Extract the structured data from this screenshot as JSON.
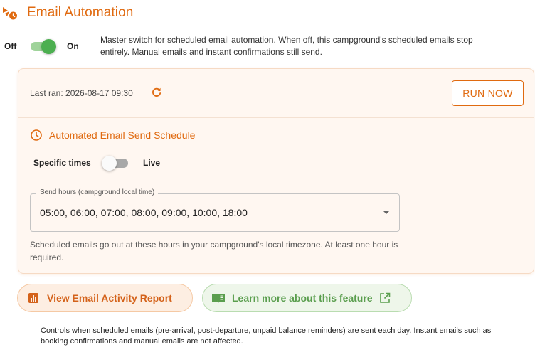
{
  "header": {
    "title": "Email Automation",
    "icon": "campground-automation-icon"
  },
  "master_switch": {
    "off_label": "Off",
    "on_label": "On",
    "state": "on",
    "description": "Master switch for scheduled email automation. When off, this campground's scheduled emails stop entirely. Manual emails and instant confirmations still send."
  },
  "status": {
    "last_ran": "Last ran: 2026-08-17 09:30",
    "refresh_icon": "refresh-icon",
    "run_now_label": "RUN NOW"
  },
  "schedule": {
    "title": "Automated Email Send Schedule",
    "icon": "clock-icon",
    "mode_left_label": "Specific times",
    "mode_right_label": "Live",
    "mode_state": "specific-times",
    "send_hours_label": "Send hours (campground local time)",
    "send_hours_value": "05:00, 06:00, 07:00, 08:00, 09:00, 10:00, 18:00",
    "helper_text": "Scheduled emails go out at these hours in your campground's local timezone. At least one hour is required."
  },
  "actions": {
    "report_label": "View Email Activity Report",
    "report_icon": "bar-chart-icon",
    "learn_label": "Learn more about this feature",
    "learn_icon": "book-icon",
    "external_icon": "external-link-icon"
  },
  "footer": {
    "note": "Controls when scheduled emails (pre-arrival, post-departure, unpaid balance reminders) are sent each day. Instant emails such as booking confirmations and manual emails are not affected."
  },
  "colors": {
    "accent": "#e06a10",
    "success": "#4caf50",
    "panel_bg": "#fff7f1"
  }
}
